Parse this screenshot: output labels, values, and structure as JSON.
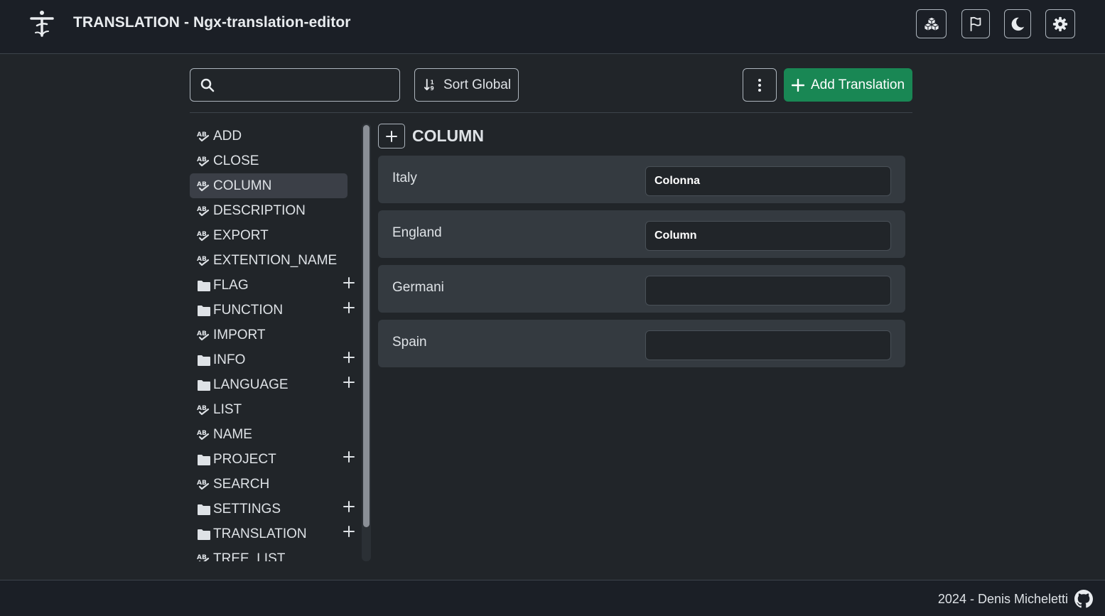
{
  "header": {
    "title": "TRANSLATION - Ngx-translation-editor",
    "logo_icon": "translation-logo-icon",
    "actions": [
      {
        "name": "cubes-button",
        "icon": "cubes-icon"
      },
      {
        "name": "flag-button",
        "icon": "flag-icon"
      },
      {
        "name": "theme-toggle-button",
        "icon": "moon-icon"
      },
      {
        "name": "settings-button",
        "icon": "gear-icon"
      }
    ]
  },
  "toolbar": {
    "search_placeholder": "",
    "search_value": "",
    "sort_label": "Sort Global",
    "add_label": "Add Translation"
  },
  "tree": {
    "items": [
      {
        "label": "ADD",
        "type": "key"
      },
      {
        "label": "CLOSE",
        "type": "key"
      },
      {
        "label": "COLUMN",
        "type": "key",
        "selected": true
      },
      {
        "label": "DESCRIPTION",
        "type": "key"
      },
      {
        "label": "EXPORT",
        "type": "key"
      },
      {
        "label": "EXTENTION_NAME",
        "type": "key"
      },
      {
        "label": "FLAG",
        "type": "folder"
      },
      {
        "label": "FUNCTION",
        "type": "folder"
      },
      {
        "label": "IMPORT",
        "type": "key"
      },
      {
        "label": "INFO",
        "type": "folder"
      },
      {
        "label": "LANGUAGE",
        "type": "folder"
      },
      {
        "label": "LIST",
        "type": "key"
      },
      {
        "label": "NAME",
        "type": "key"
      },
      {
        "label": "PROJECT",
        "type": "folder"
      },
      {
        "label": "SEARCH",
        "type": "key"
      },
      {
        "label": "SETTINGS",
        "type": "folder"
      },
      {
        "label": "TRANSLATION",
        "type": "folder"
      },
      {
        "label": "TREE_LIST",
        "type": "key"
      }
    ]
  },
  "detail": {
    "title": "COLUMN",
    "languages": [
      {
        "label": "Italy",
        "value": "Colonna"
      },
      {
        "label": "England",
        "value": "Column"
      },
      {
        "label": "Germani",
        "value": ""
      },
      {
        "label": "Spain",
        "value": ""
      }
    ]
  },
  "footer": {
    "text": "2024 - Denis Micheletti",
    "icon": "github-icon"
  },
  "colors": {
    "background": "#212529",
    "header": "#1b1f26",
    "accent_green": "#198754",
    "panel": "#343a40"
  }
}
